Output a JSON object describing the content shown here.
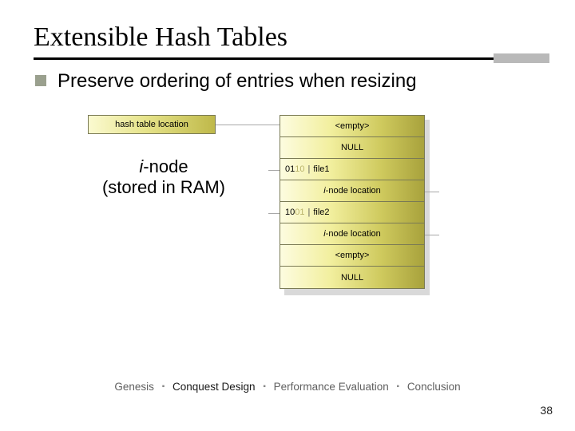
{
  "title": "Extensible Hash Tables",
  "bullet": "Preserve ordering of entries when resizing",
  "diagram": {
    "left_label": "hash table location",
    "inode_line1_i": "i",
    "inode_line1_rest": "-node",
    "inode_line2": "(stored in RAM)",
    "cells": {
      "c0": "<empty>",
      "c1": "NULL",
      "c2_prefix": "01",
      "c2_faded": "10",
      "c2_sep": " | ",
      "c2_file": "file1",
      "c3_i": "i",
      "c3_rest": "-node location",
      "c4_prefix": "10",
      "c4_faded": "01",
      "c4_sep": " | ",
      "c4_file": "file2",
      "c5_i": "i",
      "c5_rest": "-node location",
      "c6": "<empty>",
      "c7": "NULL"
    }
  },
  "footer": {
    "s1": "Genesis",
    "s2": "Conquest Design",
    "s3": "Performance Evaluation",
    "s4": "Conclusion"
  },
  "page_number": "38"
}
